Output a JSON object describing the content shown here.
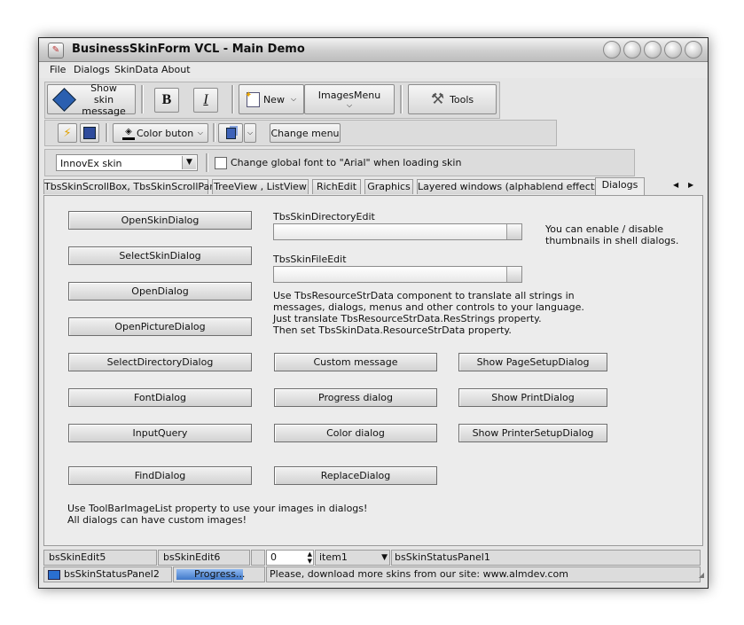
{
  "window": {
    "title": "BusinessSkinForm VCL - Main Demo"
  },
  "menu": [
    "File",
    "Dialogs",
    "SkinData",
    "About"
  ],
  "toolbar1": {
    "show_skin_message": "Show skin message",
    "bold": "B",
    "italic": "I",
    "new": "New",
    "images_menu": "ImagesMenu",
    "tools": "Tools"
  },
  "toolbar2": {
    "color_button": "Color buton",
    "change_menu": "Change menu"
  },
  "toolbar3": {
    "skin_combo": "InnovEx skin",
    "font_checkbox": "Change global font to \"Arial\" when loading skin"
  },
  "tabs": [
    "TbsSkinScrollBox, TbsSkinScrollPanel",
    "TreeView , ListView",
    "RichEdit",
    "Graphics",
    "Layered windows (alphablend effects)",
    "Dialogs"
  ],
  "active_tab": "Dialogs",
  "dialogs": {
    "col1": [
      "OpenSkinDialog",
      "SelectSkinDialog",
      "OpenDialog",
      "OpenPictureDialog",
      "SelectDirectoryDialog",
      "FontDialog",
      "InputQuery",
      "FindDialog"
    ],
    "col2": [
      "Custom message",
      "Progress dialog",
      "Color dialog",
      "ReplaceDialog"
    ],
    "col3": [
      "Show PageSetupDialog",
      "Show PrintDialog",
      "Show PrinterSetupDialog"
    ],
    "dir_edit_label": "TbsSkinDirectoryEdit",
    "file_edit_label": "TbsSkinFileEdit",
    "thumb_note": [
      "You can enable / disable",
      "thumbnails in shell dialogs."
    ],
    "resource_note": [
      "Use TbsResourceStrData component to translate all strings in",
      "messages, dialogs, menus and other controls to your language.",
      "Just translate TbsResourceStrData.ResStrings property.",
      "Then set TbsSkinData.ResourceStrData property."
    ],
    "image_note": [
      "Use ToolBarImageList property to use your images in dialogs!",
      "All dialogs can have custom images!"
    ]
  },
  "statusbar": {
    "edit5": "bsSkinEdit5",
    "edit6": "bsSkinEdit6",
    "spin": "0",
    "combo": "item1",
    "panel1": "bsSkinStatusPanel1",
    "panel2": "bsSkinStatusPanel2",
    "progress_text": "Progress...",
    "message": "Please, download more skins from our site: www.almdev.com"
  },
  "colors": {
    "accent": "#3f78c9",
    "face": "#e6e6e6"
  }
}
